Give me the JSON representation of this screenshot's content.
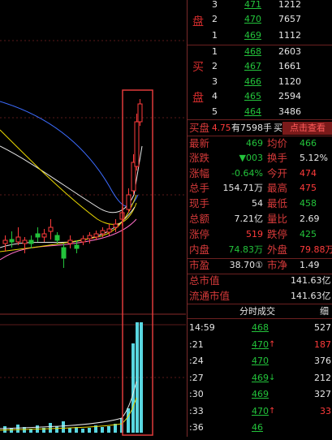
{
  "order_book": {
    "sell_label_char": "盘",
    "buy_label_chars": [
      "买",
      "盘"
    ],
    "sell_rows": [
      {
        "level": "3",
        "price": "471",
        "volume": "1212"
      },
      {
        "level": "2",
        "price": "470",
        "volume": "7657"
      },
      {
        "level": "1",
        "price": "469",
        "volume": "1112"
      }
    ],
    "buy_rows": [
      {
        "level": "1",
        "price": "468",
        "volume": "2603"
      },
      {
        "level": "2",
        "price": "467",
        "volume": "1661"
      },
      {
        "level": "3",
        "price": "466",
        "volume": "1120"
      },
      {
        "level": "4",
        "price": "465",
        "volume": "2594"
      },
      {
        "level": "5",
        "price": "464",
        "volume": "3486"
      }
    ]
  },
  "alert_row": {
    "prefix": "买盘",
    "price": "4.75",
    "mid": "有7598手",
    "suffix": "买",
    "link": "点击查看"
  },
  "quote": {
    "rows": [
      {
        "l1": "最新",
        "v1": "469",
        "l2": "均价",
        "v2": "466"
      },
      {
        "l1": "涨跌",
        "v1": "▼003",
        "l2": "换手",
        "v2": "5.12%"
      },
      {
        "l1": "涨幅",
        "v1": "-0.64%",
        "l2": "今开",
        "v2": "474"
      },
      {
        "l1": "总手",
        "v1": "154.71万",
        "l2": "最高",
        "v2": "475"
      },
      {
        "l1": "现手",
        "v1": "54",
        "l2": "最低",
        "v2": "458"
      },
      {
        "l1": "总额",
        "v1": "7.21亿",
        "l2": "量比",
        "v2": "2.69"
      },
      {
        "l1": "涨停",
        "v1": "519",
        "l2": "跌停",
        "v2": "425"
      },
      {
        "l1": "内盘",
        "v1": "74.83万",
        "l2": "外盘",
        "v2": "79.88万"
      },
      {
        "l1": "市盈",
        "v1": "38.70①",
        "l2": "市净",
        "v2": "1.49"
      }
    ],
    "market_cap_label": "总市值",
    "market_cap_value": "141.63亿",
    "float_cap_label": "流通市值",
    "float_cap_value": "141.63亿"
  },
  "ticks": {
    "header": "分时成交",
    "header_right": "细",
    "rows": [
      {
        "time": "14:59",
        "price": "468",
        "arrow": "",
        "volume": "527"
      },
      {
        "time": ":21",
        "price": "470",
        "arrow": "↑",
        "volume": "187"
      },
      {
        "time": ":24",
        "price": "470",
        "arrow": "",
        "volume": "376"
      },
      {
        "time": ":27",
        "price": "469",
        "arrow": "↓",
        "volume": "212"
      },
      {
        "time": ":30",
        "price": "469",
        "arrow": "",
        "volume": "327"
      },
      {
        "time": ":33",
        "price": "470",
        "arrow": "↑",
        "volume": "33"
      },
      {
        "time": ":36",
        "price": "46",
        "arrow": "",
        "volume": ""
      }
    ]
  },
  "colors": {
    "rise": "#ff3b3b",
    "fall": "#23c33b",
    "highlight_box": "#e03a3a",
    "volume_bar": "#59d6e0",
    "ma_white": "#e6e6e6",
    "ma_yellow": "#e8d600",
    "ma_pink": "#ff6ec7",
    "ma_blue": "#3c6cff"
  }
}
